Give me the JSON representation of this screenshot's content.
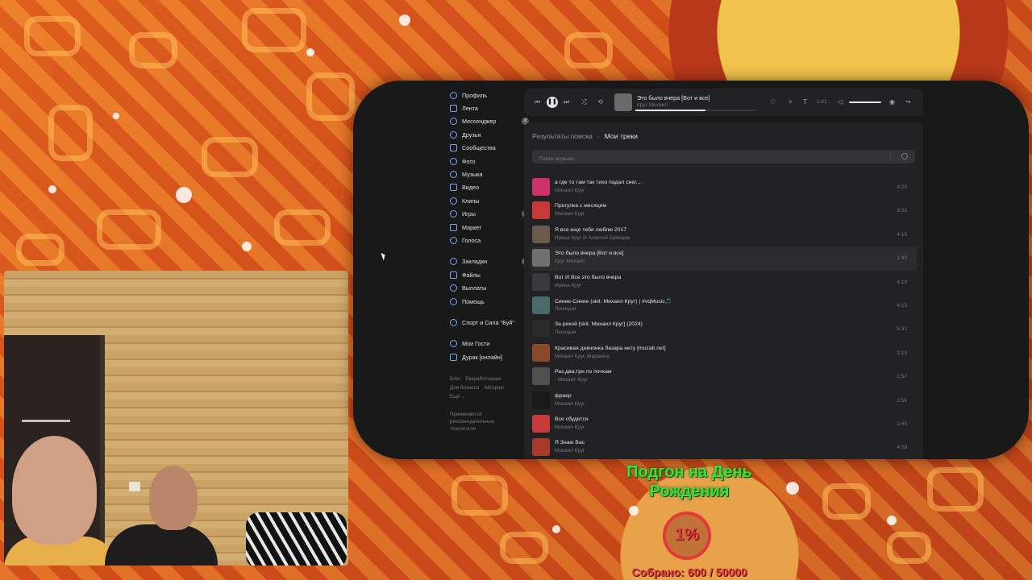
{
  "nav": {
    "items": [
      {
        "label": "Профиль",
        "icon": "user-circle-icon"
      },
      {
        "label": "Лента",
        "icon": "feed-icon"
      },
      {
        "label": "Мессенджер",
        "icon": "chat-bubble-icon",
        "badge": "2"
      },
      {
        "label": "Друзья",
        "icon": "friends-icon"
      },
      {
        "label": "Сообщества",
        "icon": "communities-icon"
      },
      {
        "label": "Фото",
        "icon": "photo-icon"
      },
      {
        "label": "Музыка",
        "icon": "music-note-icon"
      },
      {
        "label": "Видео",
        "icon": "video-icon"
      },
      {
        "label": "Клипы",
        "icon": "clips-icon"
      },
      {
        "label": "Игры",
        "icon": "games-icon",
        "badge": "2"
      },
      {
        "label": "Маркет",
        "icon": "market-bag-icon"
      },
      {
        "label": "Голоса",
        "icon": "coins-icon"
      }
    ],
    "secondary": [
      {
        "label": "Закладки",
        "icon": "bookmark-icon",
        "badge": "3"
      },
      {
        "label": "Файлы",
        "icon": "file-icon"
      },
      {
        "label": "Выплаты",
        "icon": "payout-icon"
      },
      {
        "label": "Помощь",
        "icon": "help-icon"
      }
    ],
    "apps": [
      {
        "label": "Спорт и Сила \"Буй\"",
        "icon": "app-icon"
      }
    ],
    "games": [
      {
        "label": "Мои Гости",
        "icon": "app-icon"
      },
      {
        "label": "Дурак [онлайн]",
        "icon": "gamepad-icon"
      }
    ],
    "footer_links": [
      "Блог",
      "Разработчикам",
      "Для бизнеса",
      "Авторам",
      "Ещё ⌄"
    ],
    "recommend_note": "Применяются рекомендательные технологии"
  },
  "player": {
    "title": "Это было вчера [Вот и все]",
    "artist": "Круг Михаил",
    "time": "1:41",
    "progress": 0.58,
    "volume": 0.85
  },
  "main": {
    "breadcrumb_parent": "Результаты поиска",
    "breadcrumb_current": "Мои треки",
    "search_placeholder": "Поиск музыки"
  },
  "tracks": [
    {
      "title": "а где то там так тихо падал снег....",
      "artist": "Михаил Круг",
      "duration": "4:23",
      "cover": "#d0306a"
    },
    {
      "title": "Прогулка с месяцем",
      "artist": "Михаил Круг",
      "duration": "3:22",
      "cover": "#c83a3a"
    },
    {
      "title": "Я все еще тебя люблю 2017",
      "artist": "Ирина Круг И Алексей Брянцев",
      "duration": "4:15",
      "cover": "#6a5a4a"
    },
    {
      "title": "Это было вчера [Вот и все]",
      "artist": "Круг Михаил",
      "duration": "1:40",
      "cover": "#707070",
      "active": true
    },
    {
      "title": "Вот И Все это было вчера",
      "artist": "Ирина Круг",
      "duration": "4:19",
      "cover": "#3a3a3c"
    },
    {
      "title": "Синие-Синие (skit. Михаил Круг) | #vqMusic🎵",
      "artist": "Лисицын",
      "duration": "4:15",
      "cover": "#4a6a6a"
    },
    {
      "title": "За рекой [skit. Михаил Круг] (2024)",
      "artist": "Лисицын",
      "duration": "5:31",
      "cover": "#2a2a2a"
    },
    {
      "title": "Красивая девчонка базара нету [muzab.net]",
      "artist": "Михаил Круг, Маракеш",
      "duration": "3:18",
      "cover": "#8a4a2a"
    },
    {
      "title": "Раз,два,три по почкам",
      "artist": "- Михаил Круг",
      "duration": "2:57",
      "cover": "#505050"
    },
    {
      "title": "фраер",
      "artist": "Михаил Круг",
      "duration": "2:56",
      "cover": "#1a1a1a"
    },
    {
      "title": "Все сбудется",
      "artist": "Михаил Круг",
      "duration": "2:45",
      "cover": "#c83a3a"
    },
    {
      "title": "Я Знаю Вас",
      "artist": "Михаил Круг",
      "duration": "4:29",
      "cover": "#a83a2a"
    }
  ],
  "overlay": {
    "goal_title": "Подгон на День Рождения",
    "goal_percent": "1%",
    "goal_collected": "Собрано: 600 / 50000",
    "goal_fraction": 0.012
  },
  "colors": {
    "accent": "#71aaeb",
    "goal_green": "#3fdc3f",
    "goal_red": "#e83b3b"
  }
}
